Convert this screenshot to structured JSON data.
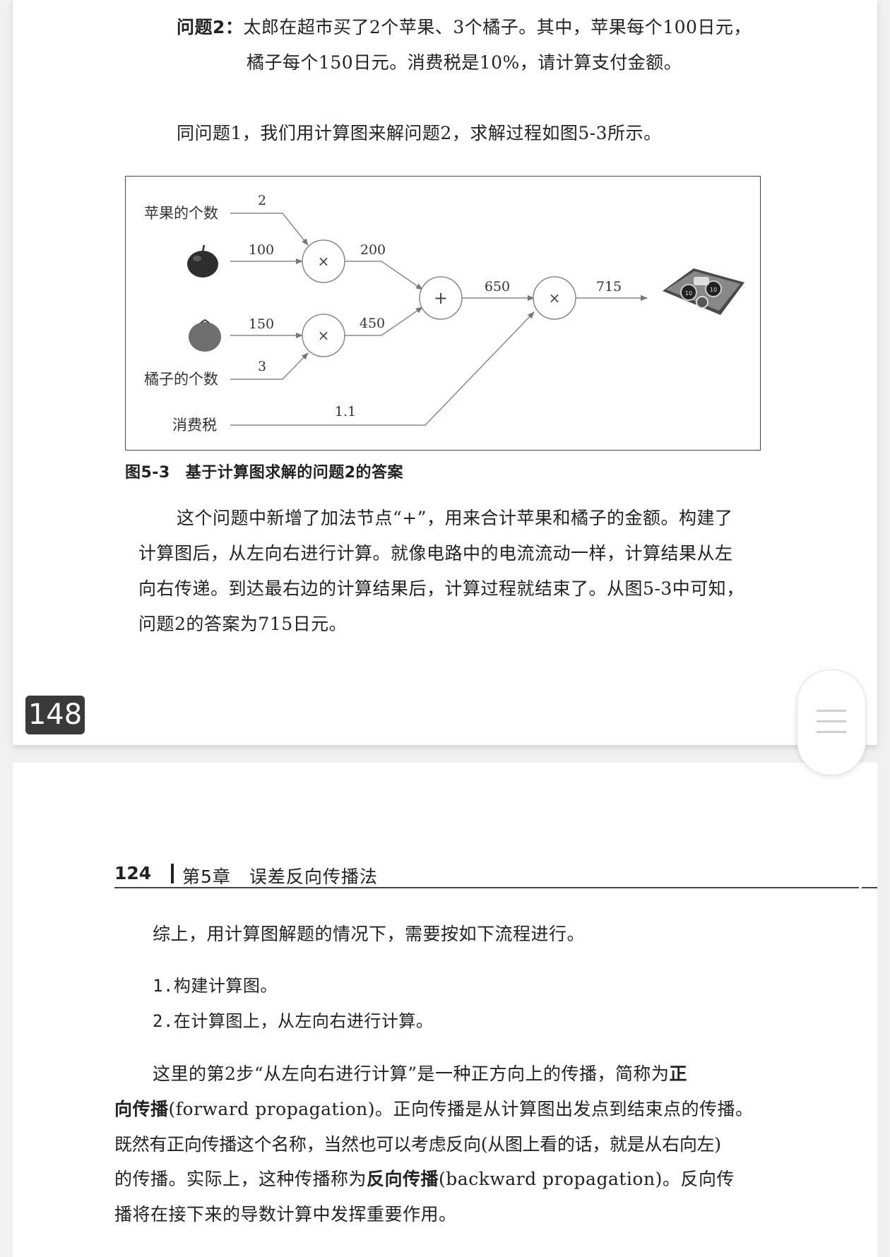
{
  "page1": {
    "question_label": "问题2：",
    "question_line1": "太郎在超市买了2个苹果、3个橘子。其中，苹果每个100日元，",
    "question_line2": "橘子每个150日元。消费税是10%，请计算支付金额。",
    "intro": "同问题1，我们用计算图来解问题2，求解过程如图5-3所示。",
    "figure": {
      "apple_count_label": "苹果的个数",
      "orange_count_label": "橘子的个数",
      "tax_label": "消费税",
      "apple_count": "2",
      "apple_price": "100",
      "orange_price": "150",
      "orange_count": "3",
      "tax_value": "1.1",
      "apple_subtotal": "200",
      "orange_subtotal": "450",
      "sum": "650",
      "total": "715",
      "mul_symbol": "×",
      "add_symbol": "+",
      "coin_label": "10"
    },
    "caption_num": "图5-3",
    "caption_text": "基于计算图求解的问题2的答案",
    "para_lines": [
      "这个问题中新增了加法节点“+”，用来合计苹果和橘子的金额。构建了",
      "计算图后，从左向右进行计算。就像电路中的电流流动一样，计算结果从左",
      "向右传递。到达最右边的计算结果后，计算过程就结束了。从图5-3中可知，",
      "问题2的答案为715日元。"
    ],
    "page_badge": "148"
  },
  "page2": {
    "header_page": "124",
    "header_chapter": "第5章　误差反向传播法",
    "summary": "综上，用计算图解题的情况下，需要按如下流程进行。",
    "steps": [
      "1.构建计算图。",
      "2.在计算图上，从左向右进行计算。"
    ],
    "p1_line1": "这里的第2步“从左向右进行计算”是一种正方向上的传播，简称为",
    "p1_bold1": "正",
    "p1_line2_bold": "向传播",
    "p1_line2_rest": "(forward propagation)。正向传播是从计算图出发点到结束点的传播。",
    "p1_line3": "既然有正向传播这个名称，当然也可以考虑反向(从图上看的话，就是从右向左)",
    "p1_line4_a": "的传播。实际上，这种传播称为",
    "p1_line4_bold": "反向传播",
    "p1_line4_b": "(backward propagation)。反向传",
    "p1_line5": "播将在接下来的导数计算中发挥重要作用。"
  }
}
